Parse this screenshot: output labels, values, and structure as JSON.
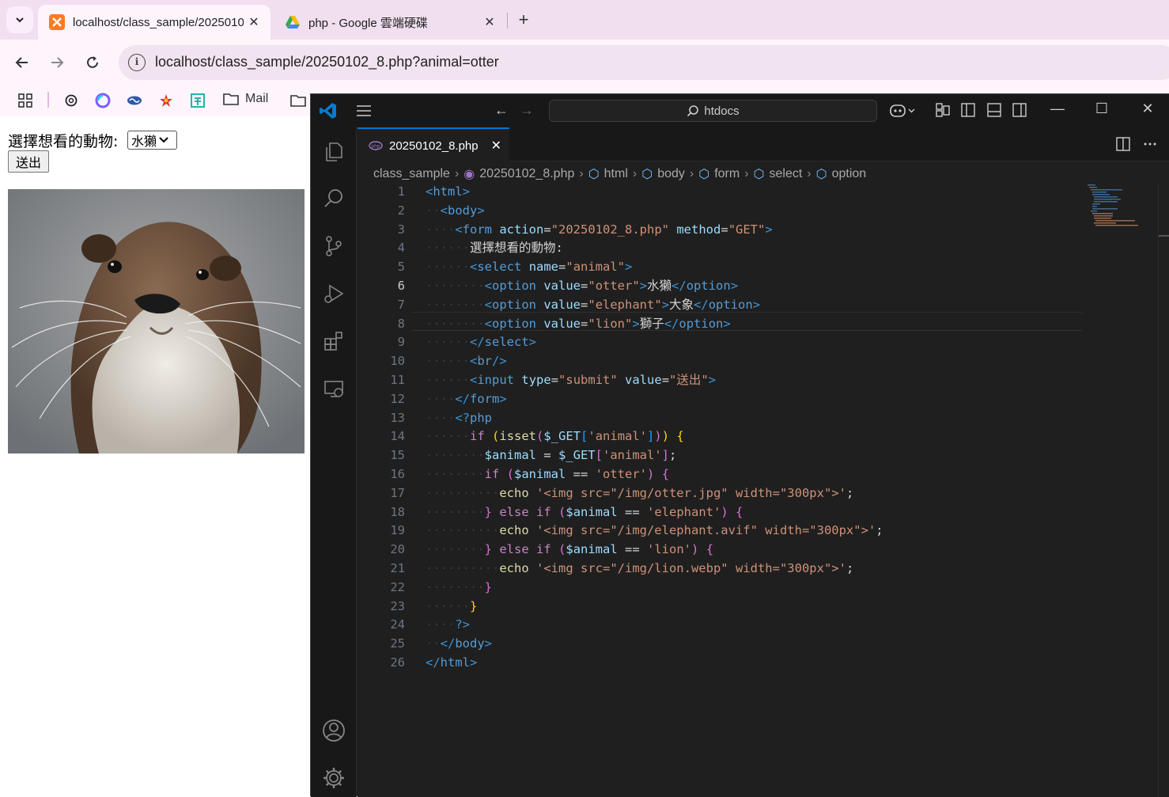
{
  "browser": {
    "tabs": [
      {
        "title": "localhost/class_sample/20250102_8.php?animal=otter"
      },
      {
        "title": "php - Google 雲端硬碟"
      }
    ],
    "url": "localhost/class_sample/20250102_8.php?animal=otter",
    "bookmarks": {
      "mail_label": "Mail"
    }
  },
  "page": {
    "form_label": "選擇想看的動物:",
    "select_value": "水獺",
    "submit_label": "送出",
    "image_alt": "otter"
  },
  "vscode": {
    "search_text": "htdocs",
    "tab": {
      "file_name": "20250102_8.php"
    },
    "breadcrumb": [
      "class_sample",
      "20250102_8.php",
      "html",
      "body",
      "form",
      "select",
      "option"
    ],
    "current_line": 6,
    "line_numbers": [
      "1",
      "2",
      "3",
      "4",
      "5",
      "6",
      "7",
      "8",
      "9",
      "10",
      "11",
      "12",
      "13",
      "14",
      "15",
      "16",
      "17",
      "18",
      "19",
      "20",
      "21",
      "22",
      "23",
      "24",
      "25",
      "26"
    ],
    "code": [
      {
        "i": "",
        "t": [
          [
            "tg",
            "<"
          ],
          [
            "tn",
            "html"
          ],
          [
            "tg",
            ">"
          ]
        ]
      },
      {
        "i": "··",
        "t": [
          [
            "tg",
            "<"
          ],
          [
            "tn",
            "body"
          ],
          [
            "tg",
            ">"
          ]
        ]
      },
      {
        "i": "····",
        "t": [
          [
            "tg",
            "<"
          ],
          [
            "tn",
            "form"
          ],
          [
            "tx",
            " "
          ],
          [
            "at",
            "action"
          ],
          [
            "tx",
            "="
          ],
          [
            "st",
            "\"20250102_8.php\""
          ],
          [
            "tx",
            " "
          ],
          [
            "at",
            "method"
          ],
          [
            "tx",
            "="
          ],
          [
            "st",
            "\"GET\""
          ],
          [
            "tg",
            ">"
          ]
        ]
      },
      {
        "i": "······",
        "t": [
          [
            "tx",
            "選擇想看的動物:"
          ]
        ]
      },
      {
        "i": "······",
        "t": [
          [
            "tg",
            "<"
          ],
          [
            "tn",
            "select"
          ],
          [
            "tx",
            " "
          ],
          [
            "at",
            "name"
          ],
          [
            "tx",
            "="
          ],
          [
            "st",
            "\"animal\""
          ],
          [
            "tg",
            ">"
          ]
        ]
      },
      {
        "i": "········",
        "t": [
          [
            "tg",
            "<"
          ],
          [
            "tn",
            "option"
          ],
          [
            "tx",
            " "
          ],
          [
            "at",
            "value"
          ],
          [
            "tx",
            "="
          ],
          [
            "st",
            "\"otter\""
          ],
          [
            "tg",
            ">"
          ],
          [
            "tx",
            "水獺"
          ],
          [
            "tg",
            "</"
          ],
          [
            "tn",
            "option"
          ],
          [
            "tg",
            ">"
          ]
        ]
      },
      {
        "i": "········",
        "t": [
          [
            "tg",
            "<"
          ],
          [
            "tn",
            "option"
          ],
          [
            "tx",
            " "
          ],
          [
            "at",
            "value"
          ],
          [
            "tx",
            "="
          ],
          [
            "st",
            "\"elephant\""
          ],
          [
            "tg",
            ">"
          ],
          [
            "tx",
            "大象"
          ],
          [
            "tg",
            "</"
          ],
          [
            "tn",
            "option"
          ],
          [
            "tg",
            ">"
          ]
        ]
      },
      {
        "i": "········",
        "t": [
          [
            "tg",
            "<"
          ],
          [
            "tn",
            "option"
          ],
          [
            "tx",
            " "
          ],
          [
            "at",
            "value"
          ],
          [
            "tx",
            "="
          ],
          [
            "st",
            "\"lion\""
          ],
          [
            "tg",
            ">"
          ],
          [
            "tx",
            "獅子"
          ],
          [
            "tg",
            "</"
          ],
          [
            "tn",
            "option"
          ],
          [
            "tg",
            ">"
          ]
        ]
      },
      {
        "i": "······",
        "t": [
          [
            "tg",
            "</"
          ],
          [
            "tn",
            "select"
          ],
          [
            "tg",
            ">"
          ]
        ]
      },
      {
        "i": "······",
        "t": [
          [
            "tg",
            "<"
          ],
          [
            "tn",
            "br"
          ],
          [
            "tg",
            "/>"
          ]
        ]
      },
      {
        "i": "······",
        "t": [
          [
            "tg",
            "<"
          ],
          [
            "tn",
            "input"
          ],
          [
            "tx",
            " "
          ],
          [
            "at",
            "type"
          ],
          [
            "tx",
            "="
          ],
          [
            "st",
            "\"submit\""
          ],
          [
            "tx",
            " "
          ],
          [
            "at",
            "value"
          ],
          [
            "tx",
            "="
          ],
          [
            "st",
            "\"送出\""
          ],
          [
            "tg",
            ">"
          ]
        ]
      },
      {
        "i": "····",
        "t": [
          [
            "tg",
            "</"
          ],
          [
            "tn",
            "form"
          ],
          [
            "tg",
            ">"
          ]
        ]
      },
      {
        "i": "····",
        "t": [
          [
            "tg",
            "<?"
          ],
          [
            "tn",
            "php"
          ]
        ]
      },
      {
        "i": "······",
        "t": [
          [
            "kw",
            "if"
          ],
          [
            "tx",
            " "
          ],
          [
            "y",
            "("
          ],
          [
            "fn",
            "isset"
          ],
          [
            "pk",
            "("
          ],
          [
            "vr",
            "$_GET"
          ],
          [
            "bl",
            "["
          ],
          [
            "st",
            "'animal'"
          ],
          [
            "bl",
            "]"
          ],
          [
            "pk",
            ")"
          ],
          [
            "y",
            ")"
          ],
          [
            "tx",
            " "
          ],
          [
            "y",
            "{"
          ]
        ]
      },
      {
        "i": "········",
        "t": [
          [
            "vr",
            "$animal"
          ],
          [
            "tx",
            " = "
          ],
          [
            "vr",
            "$_GET"
          ],
          [
            "pk",
            "["
          ],
          [
            "st",
            "'animal'"
          ],
          [
            "pk",
            "]"
          ],
          [
            "tx",
            ";"
          ]
        ]
      },
      {
        "i": "········",
        "t": [
          [
            "kw",
            "if"
          ],
          [
            "tx",
            " "
          ],
          [
            "pk",
            "("
          ],
          [
            "vr",
            "$animal"
          ],
          [
            "tx",
            " == "
          ],
          [
            "st",
            "'otter'"
          ],
          [
            "pk",
            ")"
          ],
          [
            "tx",
            " "
          ],
          [
            "pk",
            "{"
          ]
        ]
      },
      {
        "i": "··········",
        "t": [
          [
            "fn",
            "echo"
          ],
          [
            "tx",
            " "
          ],
          [
            "st",
            "'<img src=\"/img/otter.jpg\" width=\"300px\">'"
          ],
          [
            "tx",
            ";"
          ]
        ]
      },
      {
        "i": "········",
        "t": [
          [
            "pk",
            "}"
          ],
          [
            "tx",
            " "
          ],
          [
            "kw",
            "else if"
          ],
          [
            "tx",
            " "
          ],
          [
            "pk",
            "("
          ],
          [
            "vr",
            "$animal"
          ],
          [
            "tx",
            " == "
          ],
          [
            "st",
            "'elephant'"
          ],
          [
            "pk",
            ")"
          ],
          [
            "tx",
            " "
          ],
          [
            "pk",
            "{"
          ]
        ]
      },
      {
        "i": "··········",
        "t": [
          [
            "fn",
            "echo"
          ],
          [
            "tx",
            " "
          ],
          [
            "st",
            "'<img src=\"/img/elephant.avif\" width=\"300px\">'"
          ],
          [
            "tx",
            ";"
          ]
        ]
      },
      {
        "i": "········",
        "t": [
          [
            "pk",
            "}"
          ],
          [
            "tx",
            " "
          ],
          [
            "kw",
            "else if"
          ],
          [
            "tx",
            " "
          ],
          [
            "pk",
            "("
          ],
          [
            "vr",
            "$animal"
          ],
          [
            "tx",
            " == "
          ],
          [
            "st",
            "'lion'"
          ],
          [
            "pk",
            ")"
          ],
          [
            "tx",
            " "
          ],
          [
            "pk",
            "{"
          ]
        ]
      },
      {
        "i": "··········",
        "t": [
          [
            "fn",
            "echo"
          ],
          [
            "tx",
            " "
          ],
          [
            "st",
            "'<img src=\"/img/lion.webp\" width=\"300px\">'"
          ],
          [
            "tx",
            ";"
          ]
        ]
      },
      {
        "i": "········",
        "t": [
          [
            "pk",
            "}"
          ]
        ]
      },
      {
        "i": "······",
        "t": [
          [
            "y",
            "}"
          ]
        ]
      },
      {
        "i": "····",
        "t": [
          [
            "tg",
            "?>"
          ]
        ]
      },
      {
        "i": "··",
        "t": [
          [
            "tg",
            "</"
          ],
          [
            "tn",
            "body"
          ],
          [
            "tg",
            ">"
          ]
        ]
      },
      {
        "i": "",
        "t": [
          [
            "tg",
            "</"
          ],
          [
            "tn",
            "html"
          ],
          [
            "tg",
            ">"
          ]
        ]
      }
    ]
  }
}
